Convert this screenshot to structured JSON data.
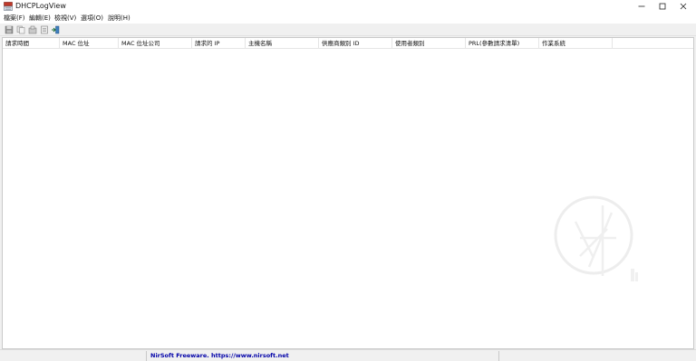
{
  "window": {
    "title": "DHCPLogView",
    "icons": {
      "app": "dhcp-log-icon",
      "minimize": "minimize-icon",
      "maximize": "maximize-icon",
      "close": "close-icon"
    }
  },
  "menu": {
    "file": "檔案(F)",
    "edit": "編輯(E)",
    "view": "檢視(V)",
    "options": "選項(O)",
    "help": "說明(H)"
  },
  "toolbar": {
    "icons": [
      "save-icon",
      "copy-icon",
      "properties-icon",
      "html-report-icon",
      "exit-icon"
    ]
  },
  "table": {
    "columns": [
      "請求時間",
      "MAC 位址",
      "MAC 位址公司",
      "請求的 IP",
      "主機名稱",
      "供應商類別 ID",
      "使用者類別",
      "PRL(參數請求清單)",
      "作業系統"
    ],
    "rows": []
  },
  "statusbar": {
    "left": "",
    "center": "NirSoft Freeware. https://www.nirsoft.net",
    "right": ""
  },
  "colors": {
    "link": "#0000a8",
    "background": "#f0f0f0"
  }
}
